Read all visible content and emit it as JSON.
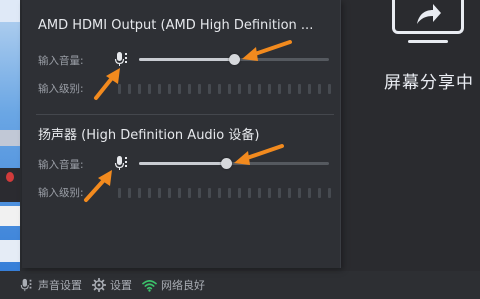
{
  "share_app": {
    "status_label": "屏幕分享中",
    "icon": "screen-share-icon"
  },
  "audio_popup": {
    "devices": [
      {
        "title": "AMD HDMI Output (AMD High Definition ...",
        "input_volume_label": "输入音量:",
        "input_level_label": "输入级别:",
        "volume_percent": 50
      },
      {
        "title": "扬声器 (High Definition Audio 设备)",
        "input_volume_label": "输入音量:",
        "input_level_label": "输入级别:",
        "volume_percent": 46
      }
    ],
    "annotation_color": "#f28a1e"
  },
  "footer": {
    "sound_settings": "声音设置",
    "settings": "设置",
    "network_status": "网络良好",
    "network_color": "#3cc26a"
  }
}
